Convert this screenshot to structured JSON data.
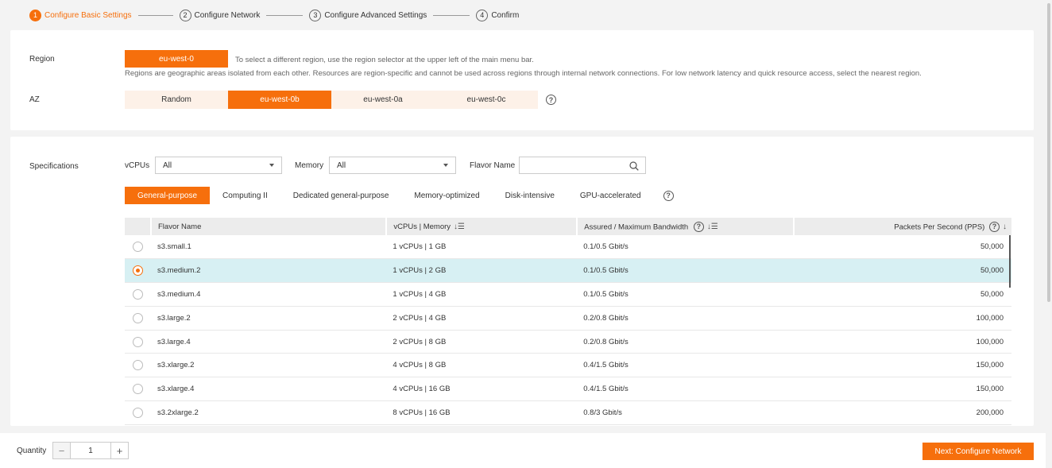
{
  "steps": [
    {
      "num": "1",
      "label": "Configure Basic Settings"
    },
    {
      "num": "2",
      "label": "Configure Network"
    },
    {
      "num": "3",
      "label": "Configure Advanced Settings"
    },
    {
      "num": "4",
      "label": "Confirm"
    }
  ],
  "region": {
    "label": "Region",
    "selected": "eu-west-0",
    "hint": "To select a different region, use the region selector at the upper left of the main menu bar.",
    "description": "Regions are geographic areas isolated from each other. Resources are region-specific and cannot be used across regions through internal network connections. For low network latency and quick resource access, select the nearest region."
  },
  "az": {
    "label": "AZ",
    "options": [
      "Random",
      "eu-west-0b",
      "eu-west-0a",
      "eu-west-0c"
    ],
    "selected": "eu-west-0b"
  },
  "specifications": {
    "label": "Specifications",
    "vcpus_label": "vCPUs",
    "vcpus_value": "All",
    "memory_label": "Memory",
    "memory_value": "All",
    "flavor_name_label": "Flavor Name",
    "flavor_name_value": "",
    "categories": [
      "General-purpose",
      "Computing II",
      "Dedicated general-purpose",
      "Memory-optimized",
      "Disk-intensive",
      "GPU-accelerated"
    ],
    "selected_category": "General-purpose"
  },
  "table": {
    "headers": [
      "Flavor Name",
      "vCPUs | Memory",
      "Assured / Maximum Bandwidth",
      "Packets Per Second (PPS)"
    ],
    "rows": [
      {
        "name": "s3.small.1",
        "cpu_mem": "1 vCPUs | 1 GB",
        "bandwidth": "0.1/0.5 Gbit/s",
        "pps": "50,000",
        "selected": false
      },
      {
        "name": "s3.medium.2",
        "cpu_mem": "1 vCPUs | 2 GB",
        "bandwidth": "0.1/0.5 Gbit/s",
        "pps": "50,000",
        "selected": true
      },
      {
        "name": "s3.medium.4",
        "cpu_mem": "1 vCPUs | 4 GB",
        "bandwidth": "0.1/0.5 Gbit/s",
        "pps": "50,000",
        "selected": false
      },
      {
        "name": "s3.large.2",
        "cpu_mem": "2 vCPUs | 4 GB",
        "bandwidth": "0.2/0.8 Gbit/s",
        "pps": "100,000",
        "selected": false
      },
      {
        "name": "s3.large.4",
        "cpu_mem": "2 vCPUs | 8 GB",
        "bandwidth": "0.2/0.8 Gbit/s",
        "pps": "100,000",
        "selected": false
      },
      {
        "name": "s3.xlarge.2",
        "cpu_mem": "4 vCPUs | 8 GB",
        "bandwidth": "0.4/1.5 Gbit/s",
        "pps": "150,000",
        "selected": false
      },
      {
        "name": "s3.xlarge.4",
        "cpu_mem": "4 vCPUs | 16 GB",
        "bandwidth": "0.4/1.5 Gbit/s",
        "pps": "150,000",
        "selected": false
      },
      {
        "name": "s3.2xlarge.2",
        "cpu_mem": "8 vCPUs | 16 GB",
        "bandwidth": "0.8/3 Gbit/s",
        "pps": "200,000",
        "selected": false
      }
    ]
  },
  "footer": {
    "quantity_label": "Quantity",
    "quantity_value": "1",
    "next_label": "Next: Configure Network"
  },
  "colors": {
    "accent": "#f66f0c",
    "selected_row": "#d7f0f3"
  }
}
